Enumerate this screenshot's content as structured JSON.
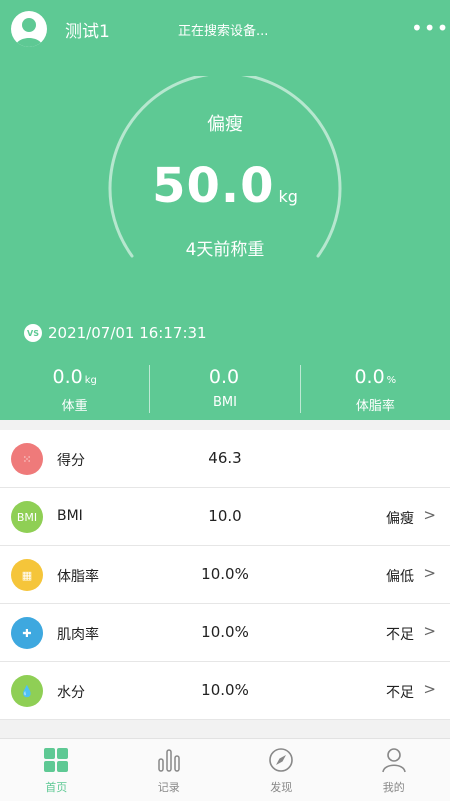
{
  "header": {
    "username": "测试1",
    "search_status": "正在搜索设备...",
    "more_label": "•••",
    "body_status": "偏瘦",
    "weight": "50.0",
    "weight_unit": "kg",
    "weighed_ago": "4天前称重",
    "vs_label": "VS",
    "timestamp": "2021/07/01 16:17:31",
    "stats": [
      {
        "value": "0.0",
        "unit": "kg",
        "label": "体重"
      },
      {
        "value": "0.0",
        "unit": "",
        "label": "BMI"
      },
      {
        "value": "0.0",
        "unit": "%",
        "label": "体脂率"
      }
    ]
  },
  "metrics": [
    {
      "name": "得分",
      "value": "46.3",
      "level": "",
      "arrow": "",
      "icon": "score-icon",
      "icon_text": "⁙",
      "color": "#ef7a7a"
    },
    {
      "name": "BMI",
      "value": "10.0",
      "level": "偏瘦",
      "arrow": ">",
      "icon": "bmi-icon",
      "icon_text": "BMI",
      "color": "#8fcf55"
    },
    {
      "name": "体脂率",
      "value": "10.0%",
      "level": "偏低",
      "arrow": ">",
      "icon": "body-fat-icon",
      "icon_text": "▦",
      "color": "#f5c53a"
    },
    {
      "name": "肌肉率",
      "value": "10.0%",
      "level": "不足",
      "arrow": ">",
      "icon": "muscle-icon",
      "icon_text": "✚",
      "color": "#3ea8df"
    },
    {
      "name": "水分",
      "value": "10.0%",
      "level": "不足",
      "arrow": ">",
      "icon": "water-icon",
      "icon_text": "💧",
      "color": "#8fcf55"
    }
  ],
  "tabs": [
    {
      "label": "首页",
      "icon": "home-icon",
      "active": true
    },
    {
      "label": "记录",
      "icon": "chart-icon",
      "active": false
    },
    {
      "label": "发现",
      "icon": "compass-icon",
      "active": false
    },
    {
      "label": "我的",
      "icon": "person-icon",
      "active": false
    }
  ],
  "colors": {
    "accent": "#5ec994"
  }
}
